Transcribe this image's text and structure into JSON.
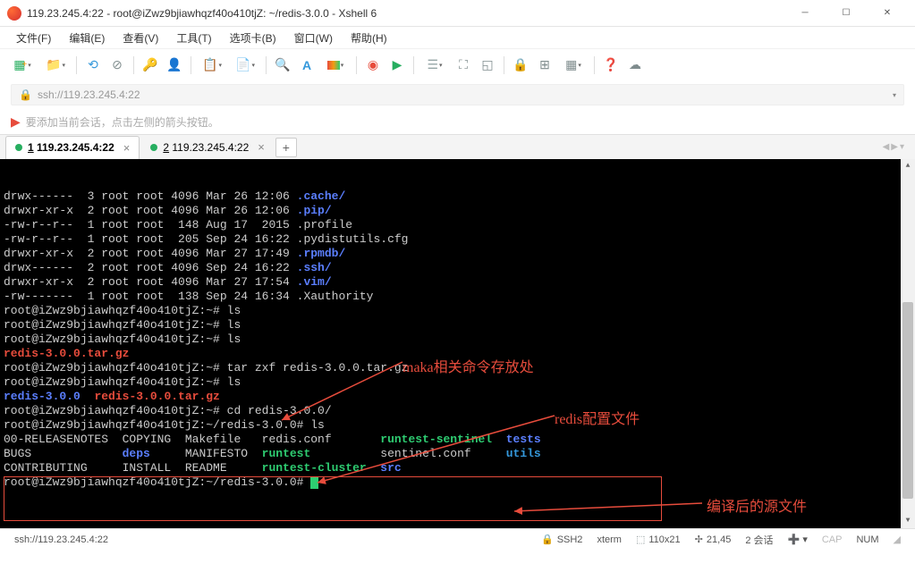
{
  "title": "119.23.245.4:22 - root@iZwz9bjiawhqzf40o410tjZ: ~/redis-3.0.0 - Xshell 6",
  "menu": [
    "文件(F)",
    "编辑(E)",
    "查看(V)",
    "工具(T)",
    "选项卡(B)",
    "窗口(W)",
    "帮助(H)"
  ],
  "address": "ssh://119.23.245.4:22",
  "hint": "要添加当前会话，点击左侧的箭头按钮。",
  "tabs": [
    {
      "label": "1 119.23.245.4:22",
      "active": true
    },
    {
      "label": "2 119.23.245.4:22",
      "active": false
    }
  ],
  "term": {
    "lines": [
      {
        "segs": [
          {
            "t": "drwx------  3 root root 4096 Mar 26 12:06 "
          },
          {
            "t": ".cache/",
            "c": "blue"
          }
        ]
      },
      {
        "segs": [
          {
            "t": "drwxr-xr-x  2 root root 4096 Mar 26 12:06 "
          },
          {
            "t": ".pip/",
            "c": "blue"
          }
        ]
      },
      {
        "segs": [
          {
            "t": "-rw-r--r--  1 root root  148 Aug 17  2015 .profile"
          }
        ]
      },
      {
        "segs": [
          {
            "t": "-rw-r--r--  1 root root  205 Sep 24 16:22 .pydistutils.cfg"
          }
        ]
      },
      {
        "segs": [
          {
            "t": "drwxr-xr-x  2 root root 4096 Mar 27 17:49 "
          },
          {
            "t": ".rpmdb/",
            "c": "blue"
          }
        ]
      },
      {
        "segs": [
          {
            "t": "drwx------  2 root root 4096 Sep 24 16:22 "
          },
          {
            "t": ".ssh/",
            "c": "blue"
          }
        ]
      },
      {
        "segs": [
          {
            "t": "drwxr-xr-x  2 root root 4096 Mar 27 17:54 "
          },
          {
            "t": ".vim/",
            "c": "blue"
          }
        ]
      },
      {
        "segs": [
          {
            "t": "-rw-------  1 root root  138 Sep 24 16:34 .Xauthority"
          }
        ]
      },
      {
        "segs": [
          {
            "t": "root@iZwz9bjiawhqzf40o410tjZ:~# ls"
          }
        ]
      },
      {
        "segs": [
          {
            "t": "root@iZwz9bjiawhqzf40o410tjZ:~# ls"
          }
        ]
      },
      {
        "segs": [
          {
            "t": "root@iZwz9bjiawhqzf40o410tjZ:~# ls"
          }
        ]
      },
      {
        "segs": [
          {
            "t": "redis-3.0.0.tar.gz",
            "c": "red"
          }
        ]
      },
      {
        "segs": [
          {
            "t": "root@iZwz9bjiawhqzf40o410tjZ:~# tar zxf redis-3.0.0.tar.gz"
          }
        ]
      },
      {
        "segs": [
          {
            "t": "root@iZwz9bjiawhqzf40o410tjZ:~# ls"
          }
        ]
      },
      {
        "segs": [
          {
            "t": "redis-3.0.0",
            "c": "blue"
          },
          {
            "t": "  "
          },
          {
            "t": "redis-3.0.0.tar.gz",
            "c": "red"
          }
        ]
      },
      {
        "segs": [
          {
            "t": "root@iZwz9bjiawhqzf40o410tjZ:~# cd redis-3.0.0/"
          }
        ]
      },
      {
        "segs": [
          {
            "t": "root@iZwz9bjiawhqzf40o410tjZ:~/redis-3.0.0# ls"
          }
        ]
      },
      {
        "segs": [
          {
            "t": "00-RELEASENOTES  COPYING  Makefile   redis.conf       "
          },
          {
            "t": "runtest-sentinel",
            "c": "green"
          },
          {
            "t": "  "
          },
          {
            "t": "tests",
            "c": "blue"
          }
        ]
      },
      {
        "segs": [
          {
            "t": "BUGS             "
          },
          {
            "t": "deps",
            "c": "blue"
          },
          {
            "t": "     MANIFESTO  "
          },
          {
            "t": "runtest",
            "c": "green"
          },
          {
            "t": "          sentinel.conf     "
          },
          {
            "t": "utils",
            "c": "cyan"
          }
        ]
      },
      {
        "segs": [
          {
            "t": "CONTRIBUTING     INSTALL  README     "
          },
          {
            "t": "runtest-cluster",
            "c": "green"
          },
          {
            "t": "  "
          },
          {
            "t": "src",
            "c": "blue"
          }
        ]
      },
      {
        "segs": [
          {
            "t": "root@iZwz9bjiawhqzf40o410tjZ:~/redis-3.0.0# "
          }
        ],
        "cursor": true
      }
    ]
  },
  "annotations": {
    "a1": "maka相关命令存放处",
    "a2": "redis配置文件",
    "a3": "编译后的源文件"
  },
  "status": {
    "left": "ssh://119.23.245.4:22",
    "ssh": "SSH2",
    "term": "xterm",
    "size": "110x21",
    "pos": "21,45",
    "sessions": "2 会话",
    "cap": "CAP",
    "num": "NUM"
  }
}
